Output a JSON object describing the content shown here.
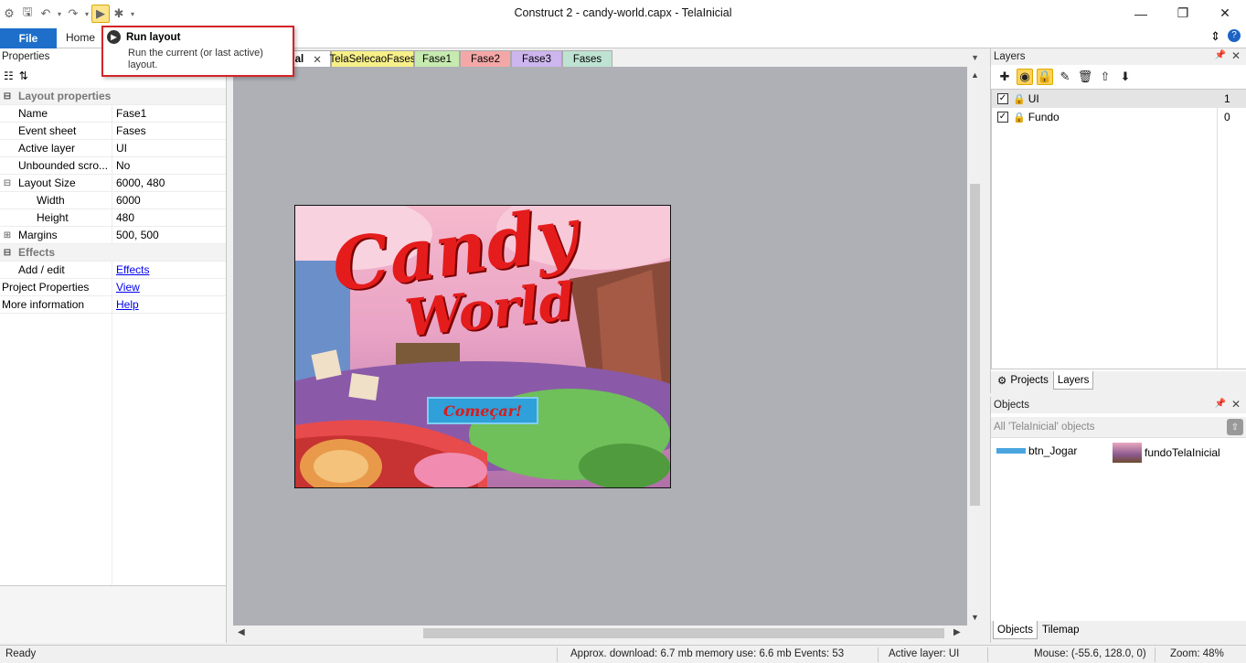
{
  "window": {
    "title": "Construct 2 - candy-world.capx - TelaInicial",
    "controls": [
      "—",
      "❐",
      "✕"
    ]
  },
  "quick_access": {
    "icons": [
      "construct-logo-icon",
      "save-icon",
      "undo-icon",
      "redo-icon",
      "run-layout-icon",
      "debug-icon",
      "customize-icon"
    ]
  },
  "ribbon": {
    "file_label": "File",
    "home_label": "Home"
  },
  "tooltip": {
    "title": "Run layout",
    "description": "Run the current (or last active) layout."
  },
  "properties": {
    "header": "Properties",
    "rows": [
      {
        "kind": "cat",
        "name": "Layout properties",
        "expander": "⊟"
      },
      {
        "name": "Name",
        "value": "Fase1"
      },
      {
        "name": "Event sheet",
        "value": "Fases"
      },
      {
        "name": "Active layer",
        "value": "UI"
      },
      {
        "name": "Unbounded scro...",
        "value": "No"
      },
      {
        "name": "Layout Size",
        "value": "6000, 480",
        "expander": "⊟"
      },
      {
        "name": "Width",
        "value": "6000",
        "indent": true
      },
      {
        "name": "Height",
        "value": "480",
        "indent": true
      },
      {
        "name": "Margins",
        "value": "500, 500",
        "expander": "⊞"
      },
      {
        "kind": "cat",
        "name": "Effects",
        "expander": "⊟"
      },
      {
        "name": "Add / edit",
        "value": "Effects",
        "link": true
      },
      {
        "name": "Project Properties",
        "value": "View",
        "link": true,
        "flush": true
      },
      {
        "name": "More information",
        "value": "Help",
        "link": true,
        "flush": true
      }
    ]
  },
  "editor": {
    "tabs": [
      {
        "label": "cial",
        "active": true,
        "color": "#ffffff"
      },
      {
        "label": "TelaSelecaoFases",
        "color": "#f7f08a"
      },
      {
        "label": "Fase1",
        "color": "#c6eab0"
      },
      {
        "label": "Fase2",
        "color": "#f4a7a7"
      },
      {
        "label": "Fase3",
        "color": "#cdb5ee"
      },
      {
        "label": "Fases",
        "color": "#bfe3d3"
      }
    ],
    "tab_close": "✕",
    "layout_title_line1": "Candy",
    "layout_title_line2": "World",
    "start_button": "Começar!"
  },
  "layers": {
    "title": "Layers",
    "items": [
      {
        "name": "UI",
        "number": "1",
        "selected": true
      },
      {
        "name": "Fundo",
        "number": "0",
        "selected": false
      }
    ],
    "tabs": [
      "Projects",
      "Layers"
    ]
  },
  "objects": {
    "title": "Objects",
    "filter": "All 'TelaInicial' objects",
    "items": [
      "btn_Jogar",
      "fundoTelaInicial"
    ],
    "tabs": [
      "Objects",
      "Tilemap"
    ]
  },
  "status": {
    "ready": "Ready",
    "download": "Approx. download: 6.7 mb  memory use: 6.6 mb  Events: 53",
    "active_layer": "Active layer: UI",
    "mouse": "Mouse: (-55.6, 128.0, 0)",
    "zoom": "Zoom: 48%"
  }
}
